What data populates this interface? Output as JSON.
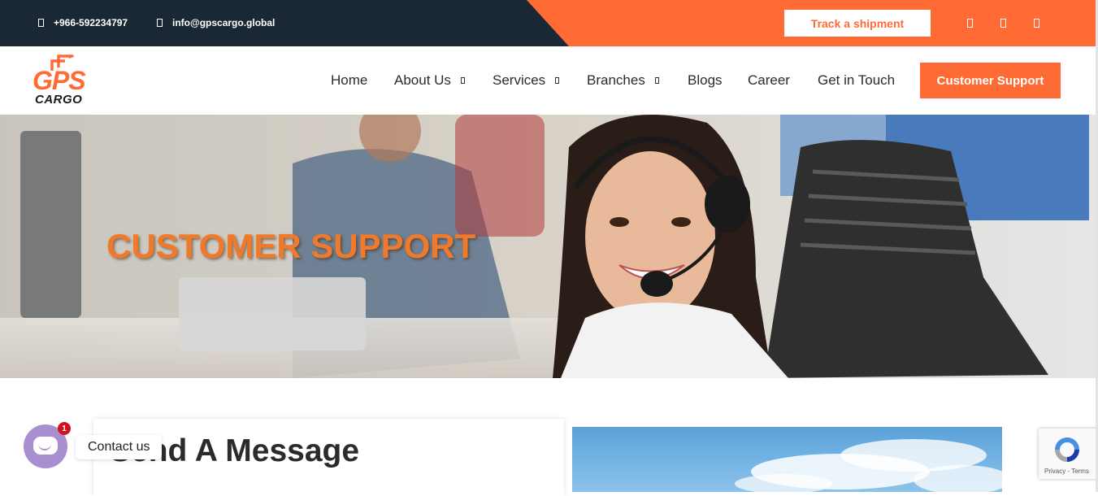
{
  "topbar": {
    "phone": "+966-592234797",
    "email": "info@gpscargo.global",
    "track_label": "Track a shipment",
    "social_icons": [
      "social-icon",
      "social-icon",
      "social-icon"
    ]
  },
  "brand": {
    "logo_top": "GPS",
    "logo_bottom": "CARGO"
  },
  "nav": {
    "items": [
      {
        "label": "Home",
        "has_dropdown": false
      },
      {
        "label": "About Us",
        "has_dropdown": true
      },
      {
        "label": "Services",
        "has_dropdown": true
      },
      {
        "label": "Branches",
        "has_dropdown": true
      },
      {
        "label": "Blogs",
        "has_dropdown": false
      },
      {
        "label": "Career",
        "has_dropdown": false
      },
      {
        "label": "Get in Touch",
        "has_dropdown": false
      }
    ],
    "cta_label": "Customer Support"
  },
  "hero": {
    "title": "CUSTOMER SUPPORT"
  },
  "content": {
    "form_title": "Send A Message"
  },
  "chat_widget": {
    "label": "Contact us",
    "badge_count": "1"
  },
  "recaptcha": {
    "links": "Privacy - Terms"
  },
  "colors": {
    "brand_orange": "#ff6b35",
    "navy": "#1a2836",
    "hero_title": "#f07a2a",
    "chat_purple": "#a98fd0"
  }
}
